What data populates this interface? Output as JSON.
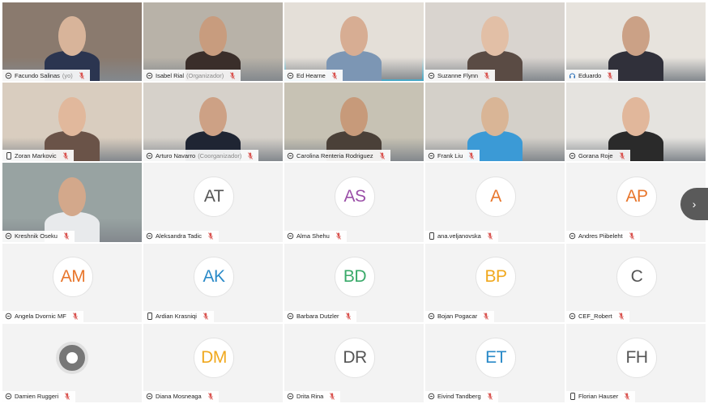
{
  "participants": [
    {
      "name": "Facundo Salinas",
      "role": "(yo)",
      "type": "video",
      "bg": "#8a7a6e",
      "skin": "#d8b49a",
      "shirt": "#2b3550",
      "device": "pc"
    },
    {
      "name": "Isabel Rial",
      "role": "(Organizador)",
      "type": "video",
      "bg": "#b8b2a8",
      "skin": "#c89c7e",
      "shirt": "#3a2e2a",
      "device": "pc"
    },
    {
      "name": "Ed Hearne",
      "role": "",
      "type": "video",
      "bg": "#e4dfd8",
      "skin": "#d7ad93",
      "shirt": "#7c96b4",
      "device": "pc",
      "active": true
    },
    {
      "name": "Suzanne Flynn",
      "role": "",
      "type": "video",
      "bg": "#d9d4cf",
      "skin": "#e2bfa6",
      "shirt": "#5a4b44",
      "device": "pc"
    },
    {
      "name": "Eduardo",
      "role": "",
      "type": "video",
      "bg": "#e7e3dd",
      "skin": "#cba186",
      "shirt": "#30303a",
      "device": "teams"
    },
    {
      "name": "Zoran Markovic",
      "role": "",
      "type": "video",
      "bg": "#d9cdbf",
      "skin": "#e1b89c",
      "shirt": "#6a5348",
      "device": "phone"
    },
    {
      "name": "Arturo Navarro",
      "role": "(Coorganizador)",
      "type": "video",
      "bg": "#d6d1ca",
      "skin": "#cda185",
      "shirt": "#1f2533",
      "device": "pc"
    },
    {
      "name": "Carolina Renteria Rodriguez",
      "role": "",
      "type": "video",
      "bg": "#c7c2b4",
      "skin": "#c79a7a",
      "shirt": "#4a4038",
      "device": "pc"
    },
    {
      "name": "Frank Liu",
      "role": "",
      "type": "video",
      "bg": "#d4d0c9",
      "skin": "#d9b596",
      "shirt": "#3b9ad6",
      "device": "pc"
    },
    {
      "name": "Gorana Roje",
      "role": "",
      "type": "video",
      "bg": "#e5e3df",
      "skin": "#e1b79b",
      "shirt": "#2a2a2a",
      "device": "pc"
    },
    {
      "name": "Kreshnik Oseku",
      "role": "",
      "type": "video",
      "bg": "#98a3a2",
      "skin": "#d3a88b",
      "shirt": "#e8eaec",
      "device": "pc"
    },
    {
      "name": "Aleksandra Tadic",
      "initials": "AT",
      "color": "#555555",
      "type": "avatar",
      "device": "pc"
    },
    {
      "name": "Alma Shehu",
      "initials": "AS",
      "color": "#9b4fa8",
      "type": "avatar",
      "device": "pc"
    },
    {
      "name": "ana.veljanovska",
      "initials": "A",
      "color": "#e8762c",
      "type": "avatar",
      "device": "phone"
    },
    {
      "name": "Andres Piibeleht",
      "initials": "AP",
      "color": "#e8762c",
      "type": "avatar",
      "device": "pc"
    },
    {
      "name": "Angela Dvornic MF",
      "initials": "AM",
      "color": "#e8762c",
      "type": "avatar",
      "device": "pc"
    },
    {
      "name": "Ardian Krasniqi",
      "initials": "AK",
      "color": "#2a8ac8",
      "type": "avatar",
      "device": "phone"
    },
    {
      "name": "Barbara Dutzler",
      "initials": "BD",
      "color": "#3aaa6a",
      "type": "avatar",
      "device": "pc"
    },
    {
      "name": "Bojan Pogacar",
      "initials": "BP",
      "color": "#f0a81e",
      "type": "avatar",
      "device": "pc"
    },
    {
      "name": "CEF_Robert",
      "initials": "C",
      "color": "#555555",
      "type": "avatar",
      "device": "pc"
    },
    {
      "name": "Damien Ruggeri",
      "initials": "",
      "color": "#555555",
      "type": "loading",
      "device": "pc"
    },
    {
      "name": "Diana Mosneaga",
      "initials": "DM",
      "color": "#f0a81e",
      "type": "avatar",
      "device": "pc"
    },
    {
      "name": "Drita Rina",
      "initials": "DR",
      "color": "#555555",
      "type": "avatar",
      "device": "pc"
    },
    {
      "name": "Eivind Tandberg",
      "initials": "ET",
      "color": "#2a8ac8",
      "type": "avatar",
      "device": "pc"
    },
    {
      "name": "Florian Hauser",
      "initials": "FH",
      "color": "#555555",
      "type": "avatar",
      "device": "phone"
    }
  ],
  "next_button": {
    "icon": "chevron-right-icon",
    "label": "›"
  },
  "colors": {
    "muted_mic": "#d9534f",
    "active_border": "#4fc3e7"
  }
}
